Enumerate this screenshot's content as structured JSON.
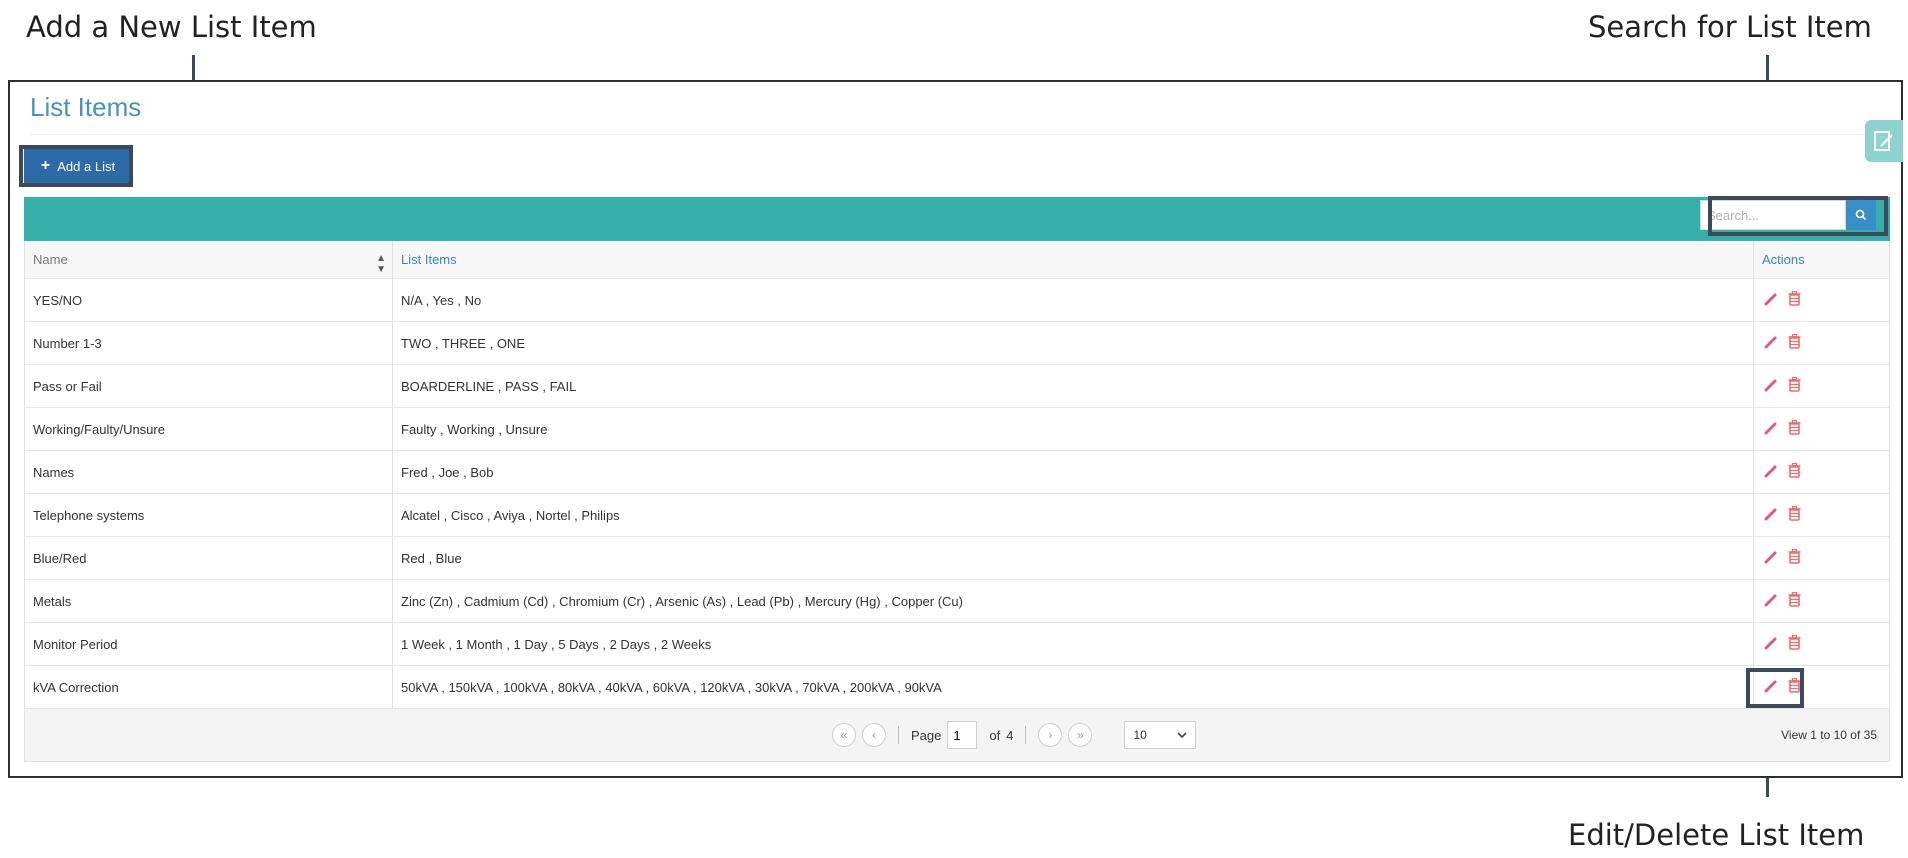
{
  "callouts": {
    "add": "Add a New List Item",
    "search": "Search for List Item",
    "edit_delete": "Edit/Delete List Item"
  },
  "page": {
    "title": "List Items",
    "add_button_label": "Add a List"
  },
  "search": {
    "placeholder": "Search..."
  },
  "table": {
    "columns": [
      "Name",
      "List Items",
      "Actions"
    ],
    "rows": [
      {
        "name": "YES/NO",
        "items": "N/A , Yes , No"
      },
      {
        "name": "Number 1-3",
        "items": "TWO , THREE , ONE"
      },
      {
        "name": "Pass or Fail",
        "items": "BOARDERLINE , PASS , FAIL"
      },
      {
        "name": "Working/Faulty/Unsure",
        "items": "Faulty , Working , Unsure"
      },
      {
        "name": "Names",
        "items": "Fred , Joe , Bob"
      },
      {
        "name": "Telephone systems",
        "items": "Alcatel , Cisco , Aviya , Nortel , Philips"
      },
      {
        "name": "Blue/Red",
        "items": "Red , Blue"
      },
      {
        "name": "Metals",
        "items": "Zinc (Zn) , Cadmium (Cd) , Chromium (Cr) , Arsenic (As) , Lead (Pb) , Mercury (Hg) , Copper (Cu)"
      },
      {
        "name": "Monitor Period",
        "items": "1 Week , 1 Month , 1 Day , 5 Days , 2 Days , 2 Weeks"
      },
      {
        "name": "kVA Correction",
        "items": "50kVA , 150kVA , 100kVA , 80kVA , 40kVA , 60kVA , 120kVA , 30kVA , 70kVA , 200kVA , 90kVA"
      }
    ]
  },
  "pager": {
    "page_label": "Page",
    "current_page": "1",
    "of_label": "of",
    "total_pages": "4",
    "rows_per_page": "10",
    "info": "View 1 to 10 of 35"
  },
  "colors": {
    "teal": "#37b0ab",
    "primary": "#2c6aa8",
    "link": "#3a86c4",
    "action_pink": "#e0578a"
  },
  "icons": [
    "plus-icon",
    "search-icon",
    "sort-icon",
    "edit-icon",
    "delete-icon",
    "first-page-icon",
    "prev-page-icon",
    "next-page-icon",
    "last-page-icon",
    "chevron-down-icon",
    "edit-panel-icon"
  ]
}
